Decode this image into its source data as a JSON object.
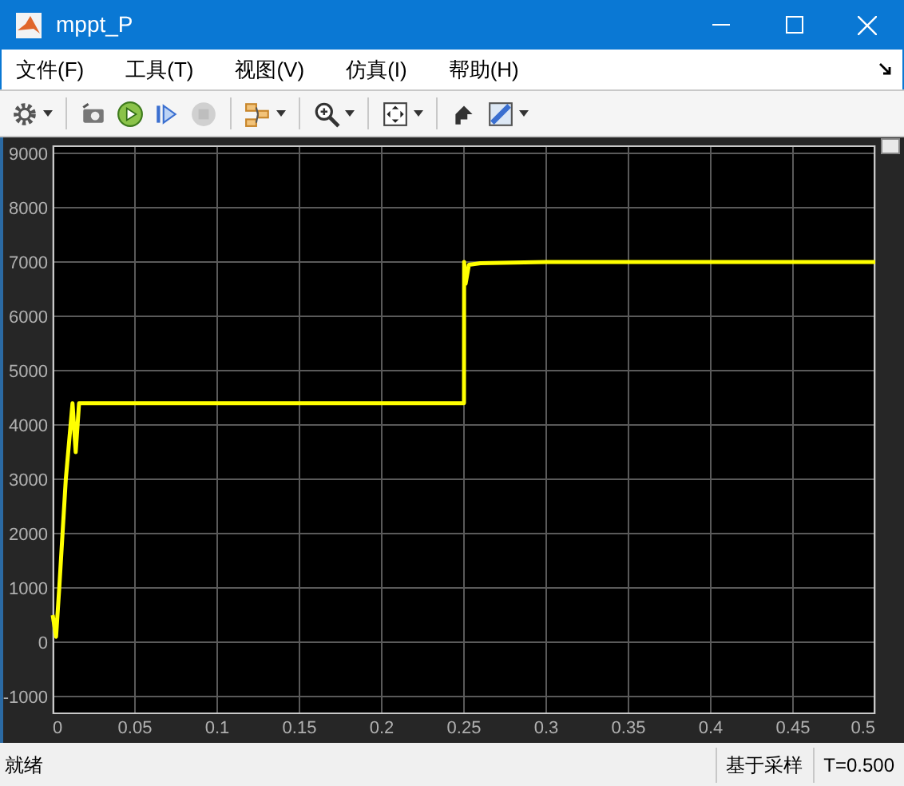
{
  "window": {
    "title": "mppt_P"
  },
  "menu": [
    "文件(F)",
    "工具(T)",
    "视图(V)",
    "仿真(I)",
    "帮助(H)"
  ],
  "toolbar": [
    [
      {
        "kind": "settings",
        "has_menu": true,
        "disabled": false
      }
    ],
    [
      {
        "kind": "camera",
        "has_menu": false,
        "disabled": false
      },
      {
        "kind": "run",
        "has_menu": false,
        "disabled": false
      },
      {
        "kind": "step",
        "has_menu": false,
        "disabled": false
      },
      {
        "kind": "stop",
        "has_menu": false,
        "disabled": true
      }
    ],
    [
      {
        "kind": "blocks",
        "has_menu": true,
        "disabled": false
      }
    ],
    [
      {
        "kind": "zoom",
        "has_menu": true,
        "disabled": false
      }
    ],
    [
      {
        "kind": "fit",
        "has_menu": true,
        "disabled": false
      }
    ],
    [
      {
        "kind": "style",
        "has_menu": false,
        "disabled": false
      },
      {
        "kind": "ruler",
        "has_menu": true,
        "disabled": false
      }
    ]
  ],
  "scope": {
    "chart_data": {
      "type": "line",
      "x": [
        0,
        0.002,
        0.004,
        0.008,
        0.012,
        0.014,
        0.016,
        0.02,
        0.05,
        0.1,
        0.15,
        0.2,
        0.25,
        0.2501,
        0.251,
        0.253,
        0.26,
        0.3,
        0.35,
        0.4,
        0.45,
        0.5
      ],
      "series": [
        {
          "color": "#ffff00",
          "values": [
            500,
            100,
            1000,
            3000,
            4400,
            3500,
            4400,
            4400,
            4400,
            4400,
            4400,
            4400,
            4400,
            7000,
            6600,
            6950,
            6980,
            7000,
            7000,
            7000,
            7000,
            7000
          ]
        }
      ],
      "xlim": [
        0,
        0.5
      ],
      "ylim": [
        -1000,
        9000
      ],
      "xticks": [
        {
          "value": 0,
          "label": "0"
        },
        0.05,
        0.1,
        0.15,
        0.2,
        0.25,
        0.3,
        0.35,
        0.4,
        0.45,
        0.5
      ],
      "yticks": [
        -1000,
        0,
        1000,
        2000,
        3000,
        4000,
        5000,
        6000,
        7000,
        8000,
        9000
      ],
      "grid": true
    }
  },
  "status_bar": {
    "message": "就绪",
    "mode": "基于采样",
    "time": "T=0.500"
  }
}
